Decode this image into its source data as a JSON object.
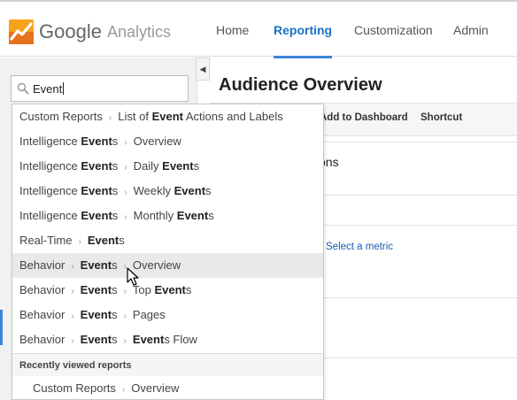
{
  "app": {
    "brand_google": "Google",
    "brand_product": "Analytics"
  },
  "nav": {
    "items": [
      {
        "label": "Home"
      },
      {
        "label": "Reporting"
      },
      {
        "label": "Customization"
      },
      {
        "label": "Admin"
      }
    ],
    "active": "Reporting",
    "accent_color": "#3b83d4"
  },
  "search": {
    "value": "Event"
  },
  "main": {
    "title": "Audience Overview",
    "actions": {
      "add_to_dashboard": "Add to Dashboard",
      "shortcut": "Shortcut"
    },
    "sessions_partial": "ons",
    "select_metric": "Select a metric"
  },
  "dropdown": {
    "items": [
      {
        "parts": [
          "Custom Reports",
          "List of ",
          "Event",
          " Actions and Labels"
        ]
      },
      {
        "parts": [
          "Intelligence ",
          "Event",
          "s",
          "Overview"
        ]
      },
      {
        "parts": [
          "Intelligence ",
          "Event",
          "s",
          "Daily ",
          "Event",
          "s"
        ]
      },
      {
        "parts": [
          "Intelligence ",
          "Event",
          "s",
          "Weekly ",
          "Event",
          "s"
        ]
      },
      {
        "parts": [
          "Intelligence ",
          "Event",
          "s",
          "Monthly ",
          "Event",
          "s"
        ]
      },
      {
        "parts": [
          "Real-Time",
          "Event",
          "s"
        ]
      },
      {
        "parts": [
          "Behavior",
          "Event",
          "s",
          "Overview"
        ]
      },
      {
        "parts": [
          "Behavior",
          "Event",
          "s",
          "Top ",
          "Event",
          "s"
        ]
      },
      {
        "parts": [
          "Behavior",
          "Event",
          "s",
          "Pages"
        ]
      },
      {
        "parts": [
          "Behavior",
          "Event",
          "s",
          "Event",
          "s Flow"
        ]
      }
    ],
    "hovered_index": 6,
    "separator": "›",
    "recent_header": "Recently viewed reports",
    "recent_item": {
      "parts": [
        "Custom Reports",
        "Overview"
      ]
    }
  },
  "icons": [
    "analytics-logo-icon",
    "search-icon",
    "collapse-left-icon",
    "mouse-pointer-icon"
  ]
}
